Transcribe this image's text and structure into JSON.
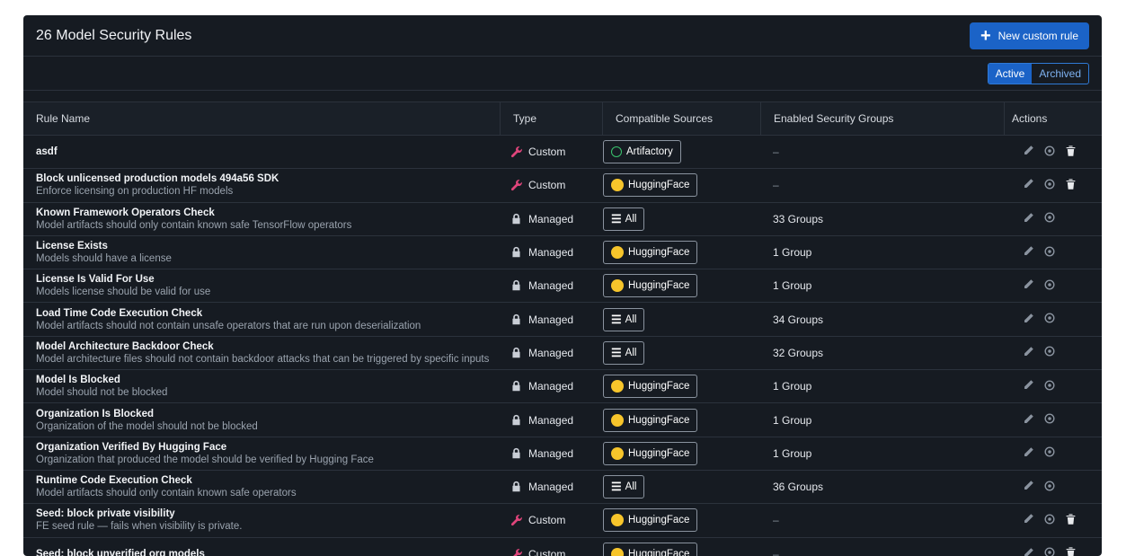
{
  "header": {
    "title": "26 Model Security Rules",
    "new_button": "New custom rule"
  },
  "filter": {
    "active": "Active",
    "archived": "Archived"
  },
  "columns": [
    "Rule Name",
    "Type",
    "Compatible Sources",
    "Enabled Security Groups",
    "Actions"
  ],
  "rows": [
    {
      "name": "asdf",
      "desc": "",
      "type": "Custom",
      "source": "Artifactory",
      "groups": "–",
      "deletable": true
    },
    {
      "name": "Block unlicensed production models 494a56 SDK",
      "desc": "Enforce licensing on production HF models",
      "type": "Custom",
      "source": "HuggingFace",
      "groups": "–",
      "deletable": true
    },
    {
      "name": "Known Framework Operators Check",
      "desc": "Model artifacts should only contain known safe TensorFlow operators",
      "type": "Managed",
      "source": "All",
      "groups": "33 Groups",
      "deletable": false
    },
    {
      "name": "License Exists",
      "desc": "Models should have a license",
      "type": "Managed",
      "source": "HuggingFace",
      "groups": "1 Group",
      "deletable": false
    },
    {
      "name": "License Is Valid For Use",
      "desc": "Models license should be valid for use",
      "type": "Managed",
      "source": "HuggingFace",
      "groups": "1 Group",
      "deletable": false
    },
    {
      "name": "Load Time Code Execution Check",
      "desc": "Model artifacts should not contain unsafe operators that are run upon deserialization",
      "type": "Managed",
      "source": "All",
      "groups": "34 Groups",
      "deletable": false
    },
    {
      "name": "Model Architecture Backdoor Check",
      "desc": "Model architecture files should not contain backdoor attacks that can be triggered by specific inputs",
      "type": "Managed",
      "source": "All",
      "groups": "32 Groups",
      "deletable": false
    },
    {
      "name": "Model Is Blocked",
      "desc": "Model should not be blocked",
      "type": "Managed",
      "source": "HuggingFace",
      "groups": "1 Group",
      "deletable": false
    },
    {
      "name": "Organization Is Blocked",
      "desc": "Organization of the model should not be blocked",
      "type": "Managed",
      "source": "HuggingFace",
      "groups": "1 Group",
      "deletable": false
    },
    {
      "name": "Organization Verified By Hugging Face",
      "desc": "Organization that produced the model should be verified by Hugging Face",
      "type": "Managed",
      "source": "HuggingFace",
      "groups": "1 Group",
      "deletable": false
    },
    {
      "name": "Runtime Code Execution Check",
      "desc": "Model artifacts should only contain known safe operators",
      "type": "Managed",
      "source": "All",
      "groups": "36 Groups",
      "deletable": false
    },
    {
      "name": "Seed: block private visibility",
      "desc": "FE seed rule — fails when visibility is private.",
      "type": "Custom",
      "source": "HuggingFace",
      "groups": "–",
      "deletable": true
    },
    {
      "name": "Seed: block unverified org models",
      "desc": "",
      "type": "Custom",
      "source": "HuggingFace",
      "groups": "–",
      "deletable": true
    }
  ],
  "colors": {
    "accent": "#1b63c7",
    "custom_icon": "#e0457b",
    "hf": "#f7c52b",
    "artifactory": "#3ac46e"
  },
  "icons": {
    "custom": "wrench-icon",
    "managed": "lock-icon",
    "edit": "pencil-icon",
    "view": "eye-icon",
    "delete": "trash-icon"
  }
}
